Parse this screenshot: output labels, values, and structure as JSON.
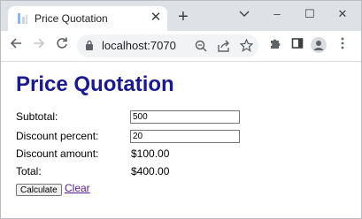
{
  "browser": {
    "tab_title": "Price Quotation",
    "tab_close_glyph": "✕",
    "new_tab_glyph": "+",
    "url": "localhost:7070",
    "window_buttons": [
      "–",
      "☐",
      "✕"
    ]
  },
  "page": {
    "heading": "Price Quotation",
    "fields": {
      "subtotal": {
        "label": "Subtotal:",
        "value": "500"
      },
      "discount_percent": {
        "label": "Discount percent:",
        "value": "20"
      },
      "discount_amount": {
        "label": "Discount amount:",
        "value": "$100.00"
      },
      "total": {
        "label": "Total:",
        "value": "$400.00"
      }
    },
    "calculate_label": "Calculate",
    "clear_label": "Clear"
  },
  "colors": {
    "heading": "#1a1a8c",
    "link_visited": "#551a8b",
    "tabstrip": "#dee1e6"
  }
}
